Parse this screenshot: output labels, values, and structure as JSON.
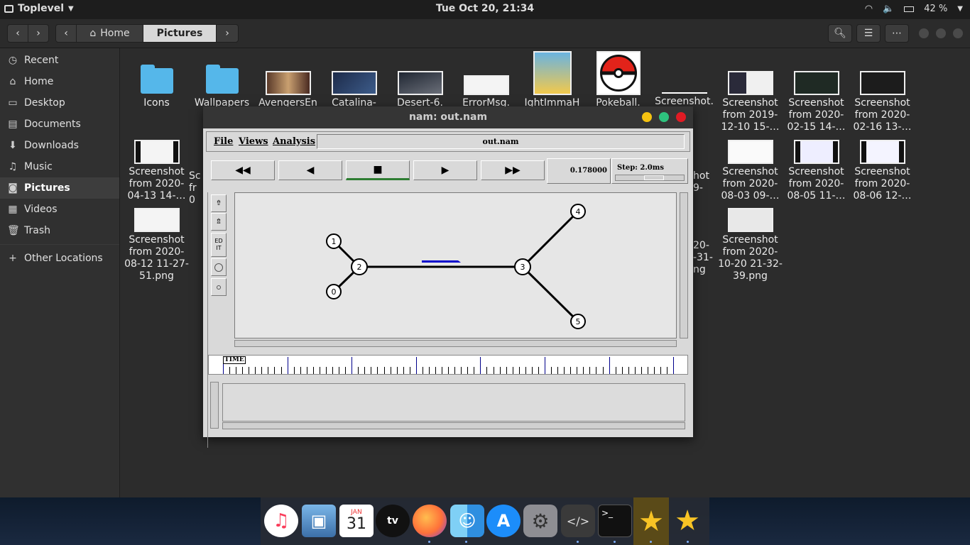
{
  "topbar": {
    "app_name": "Toplevel",
    "clock": "Tue Oct 20, 21:34",
    "battery": "42 %"
  },
  "header": {
    "breadcrumb_home": "Home",
    "breadcrumb_current": "Pictures"
  },
  "sidebar": {
    "items": [
      {
        "label": "Recent",
        "icon": "clock-icon"
      },
      {
        "label": "Home",
        "icon": "home-icon"
      },
      {
        "label": "Desktop",
        "icon": "desktop-icon"
      },
      {
        "label": "Documents",
        "icon": "documents-icon"
      },
      {
        "label": "Downloads",
        "icon": "downloads-icon"
      },
      {
        "label": "Music",
        "icon": "music-icon"
      },
      {
        "label": "Pictures",
        "icon": "camera-icon"
      },
      {
        "label": "Videos",
        "icon": "videos-icon"
      },
      {
        "label": "Trash",
        "icon": "trash-icon"
      }
    ],
    "other": "Other Locations"
  },
  "files": [
    {
      "l1": "Icons",
      "l2": "",
      "l3": ""
    },
    {
      "l1": "Wallpapers",
      "l2": "",
      "l3": ""
    },
    {
      "l1": "AvengersEn",
      "l2": "",
      "l3": ""
    },
    {
      "l1": "Catalina-",
      "l2": "",
      "l3": ""
    },
    {
      "l1": "Desert-6.",
      "l2": "",
      "l3": ""
    },
    {
      "l1": "ErrorMsg.",
      "l2": "",
      "l3": ""
    },
    {
      "l1": "IghtImmaH",
      "l2": "",
      "l3": ""
    },
    {
      "l1": "Pokeball.",
      "l2": "",
      "l3": ""
    },
    {
      "l1": "Screenshot.",
      "l2": "",
      "l3": ""
    },
    {
      "l1": "Screenshot",
      "l2": "from 2019-",
      "l3": "12-10 15-…"
    },
    {
      "l1": "Screenshot",
      "l2": "from 2020-",
      "l3": "02-15 14-…"
    },
    {
      "l1": "Screenshot",
      "l2": "from 2020-",
      "l3": "02-16 13-…"
    },
    {
      "l1": "Screenshot",
      "l2": "from 2020-",
      "l3": "04-13 14-…"
    },
    {
      "l1": "Screenshot",
      "l2": "from 2020-",
      "l3": "08-03 09-…"
    },
    {
      "l1": "Screenshot",
      "l2": "from 2020-",
      "l3": "08-05 11-…"
    },
    {
      "l1": "Screenshot",
      "l2": "from 2020-",
      "l3": "08-06 12-…"
    },
    {
      "l1": "Screenshot",
      "l2": "from 2020-",
      "l3": "08-12 11-27-"
    },
    {
      "l1": "Screenshot",
      "l2": "from 2020-",
      "l3": "10-20 21-32-"
    }
  ],
  "files_extra": {
    "f16_l4": "51.png",
    "f17_l4": "39.png",
    "partial_a": "Sc",
    "partial_b": "fr",
    "partial_c": "0",
    "partial_d": "hot",
    "partial_e": "9-",
    "partial_f": "20-",
    "partial_g": "-31-",
    "partial_h": "ng"
  },
  "nam": {
    "title": "nam: out.nam",
    "menu_file": "File",
    "menu_views": "Views",
    "menu_analysis": "Analysis",
    "filename": "out.nam",
    "time_value": "0.178000",
    "step_label": "Step: 2.0ms",
    "timeline_label": "TIME",
    "edit_label_1": "ED",
    "edit_label_2": "IT",
    "buttons": {
      "rewind": "◀◀",
      "back": "◀",
      "stop": "■",
      "play": "▶",
      "fastforward": "▶▶"
    },
    "nodes": [
      {
        "id": "0"
      },
      {
        "id": "1"
      },
      {
        "id": "2"
      },
      {
        "id": "3"
      },
      {
        "id": "4"
      },
      {
        "id": "5"
      }
    ]
  },
  "dock": {
    "calendar_month": "JAN",
    "calendar_day": "31",
    "tv_label": "tv",
    "apps": [
      "music-icon",
      "preview-icon",
      "calendar-icon",
      "apple-tv-icon",
      "firefox-icon",
      "finder-icon",
      "app-store-icon",
      "settings-icon",
      "code-editor-icon",
      "terminal-icon",
      "star-icon",
      "star-icon"
    ]
  }
}
